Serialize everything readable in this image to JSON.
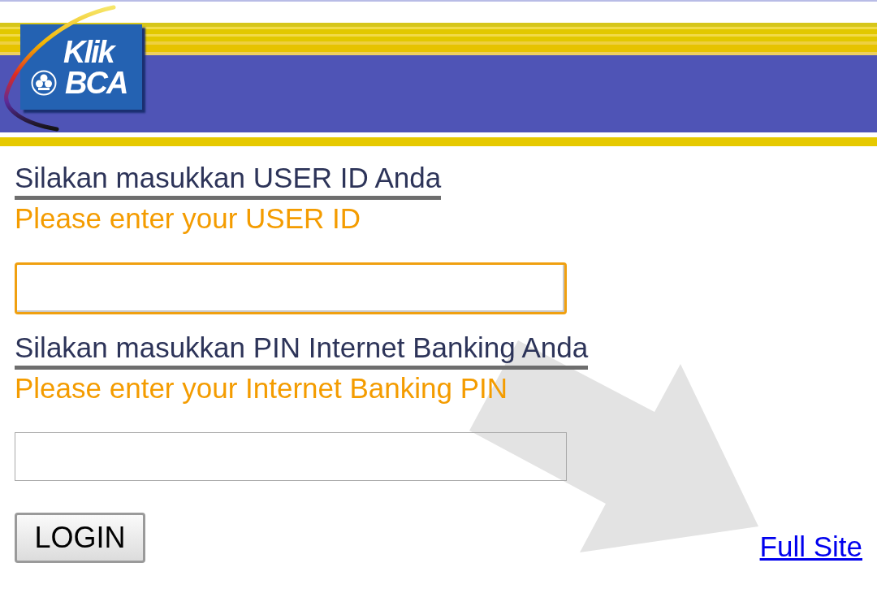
{
  "header": {
    "logo": {
      "top_word": "Klik",
      "bottom_word": "BCA"
    }
  },
  "form": {
    "fields": [
      {
        "label": "Silakan masukkan USER ID Anda",
        "label_english": "Please enter your USER ID",
        "focused": true
      },
      {
        "label": "Silakan masukkan PIN Internet Banking Anda",
        "label_english": "Please enter your Internet Banking PIN",
        "focused": false
      }
    ],
    "submit_button": "LOGIN"
  },
  "full_site_link": "Full Site"
}
